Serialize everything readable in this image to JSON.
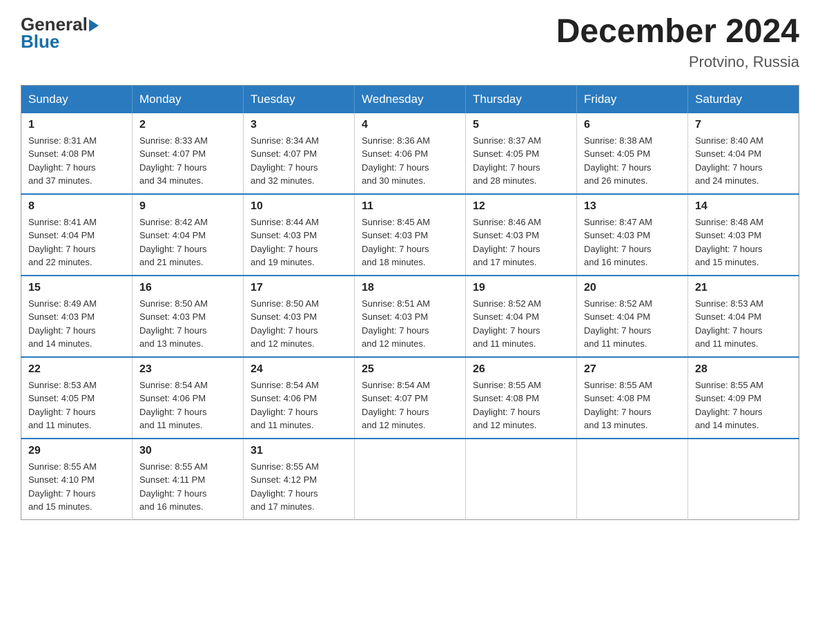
{
  "logo": {
    "general": "General",
    "blue": "Blue"
  },
  "title": "December 2024",
  "location": "Protvino, Russia",
  "weekdays": [
    "Sunday",
    "Monday",
    "Tuesday",
    "Wednesday",
    "Thursday",
    "Friday",
    "Saturday"
  ],
  "weeks": [
    [
      {
        "day": "1",
        "sunrise": "8:31 AM",
        "sunset": "4:08 PM",
        "daylight": "7 hours and 37 minutes."
      },
      {
        "day": "2",
        "sunrise": "8:33 AM",
        "sunset": "4:07 PM",
        "daylight": "7 hours and 34 minutes."
      },
      {
        "day": "3",
        "sunrise": "8:34 AM",
        "sunset": "4:07 PM",
        "daylight": "7 hours and 32 minutes."
      },
      {
        "day": "4",
        "sunrise": "8:36 AM",
        "sunset": "4:06 PM",
        "daylight": "7 hours and 30 minutes."
      },
      {
        "day": "5",
        "sunrise": "8:37 AM",
        "sunset": "4:05 PM",
        "daylight": "7 hours and 28 minutes."
      },
      {
        "day": "6",
        "sunrise": "8:38 AM",
        "sunset": "4:05 PM",
        "daylight": "7 hours and 26 minutes."
      },
      {
        "day": "7",
        "sunrise": "8:40 AM",
        "sunset": "4:04 PM",
        "daylight": "7 hours and 24 minutes."
      }
    ],
    [
      {
        "day": "8",
        "sunrise": "8:41 AM",
        "sunset": "4:04 PM",
        "daylight": "7 hours and 22 minutes."
      },
      {
        "day": "9",
        "sunrise": "8:42 AM",
        "sunset": "4:04 PM",
        "daylight": "7 hours and 21 minutes."
      },
      {
        "day": "10",
        "sunrise": "8:44 AM",
        "sunset": "4:03 PM",
        "daylight": "7 hours and 19 minutes."
      },
      {
        "day": "11",
        "sunrise": "8:45 AM",
        "sunset": "4:03 PM",
        "daylight": "7 hours and 18 minutes."
      },
      {
        "day": "12",
        "sunrise": "8:46 AM",
        "sunset": "4:03 PM",
        "daylight": "7 hours and 17 minutes."
      },
      {
        "day": "13",
        "sunrise": "8:47 AM",
        "sunset": "4:03 PM",
        "daylight": "7 hours and 16 minutes."
      },
      {
        "day": "14",
        "sunrise": "8:48 AM",
        "sunset": "4:03 PM",
        "daylight": "7 hours and 15 minutes."
      }
    ],
    [
      {
        "day": "15",
        "sunrise": "8:49 AM",
        "sunset": "4:03 PM",
        "daylight": "7 hours and 14 minutes."
      },
      {
        "day": "16",
        "sunrise": "8:50 AM",
        "sunset": "4:03 PM",
        "daylight": "7 hours and 13 minutes."
      },
      {
        "day": "17",
        "sunrise": "8:50 AM",
        "sunset": "4:03 PM",
        "daylight": "7 hours and 12 minutes."
      },
      {
        "day": "18",
        "sunrise": "8:51 AM",
        "sunset": "4:03 PM",
        "daylight": "7 hours and 12 minutes."
      },
      {
        "day": "19",
        "sunrise": "8:52 AM",
        "sunset": "4:04 PM",
        "daylight": "7 hours and 11 minutes."
      },
      {
        "day": "20",
        "sunrise": "8:52 AM",
        "sunset": "4:04 PM",
        "daylight": "7 hours and 11 minutes."
      },
      {
        "day": "21",
        "sunrise": "8:53 AM",
        "sunset": "4:04 PM",
        "daylight": "7 hours and 11 minutes."
      }
    ],
    [
      {
        "day": "22",
        "sunrise": "8:53 AM",
        "sunset": "4:05 PM",
        "daylight": "7 hours and 11 minutes."
      },
      {
        "day": "23",
        "sunrise": "8:54 AM",
        "sunset": "4:06 PM",
        "daylight": "7 hours and 11 minutes."
      },
      {
        "day": "24",
        "sunrise": "8:54 AM",
        "sunset": "4:06 PM",
        "daylight": "7 hours and 11 minutes."
      },
      {
        "day": "25",
        "sunrise": "8:54 AM",
        "sunset": "4:07 PM",
        "daylight": "7 hours and 12 minutes."
      },
      {
        "day": "26",
        "sunrise": "8:55 AM",
        "sunset": "4:08 PM",
        "daylight": "7 hours and 12 minutes."
      },
      {
        "day": "27",
        "sunrise": "8:55 AM",
        "sunset": "4:08 PM",
        "daylight": "7 hours and 13 minutes."
      },
      {
        "day": "28",
        "sunrise": "8:55 AM",
        "sunset": "4:09 PM",
        "daylight": "7 hours and 14 minutes."
      }
    ],
    [
      {
        "day": "29",
        "sunrise": "8:55 AM",
        "sunset": "4:10 PM",
        "daylight": "7 hours and 15 minutes."
      },
      {
        "day": "30",
        "sunrise": "8:55 AM",
        "sunset": "4:11 PM",
        "daylight": "7 hours and 16 minutes."
      },
      {
        "day": "31",
        "sunrise": "8:55 AM",
        "sunset": "4:12 PM",
        "daylight": "7 hours and 17 minutes."
      },
      null,
      null,
      null,
      null
    ]
  ],
  "labels": {
    "sunrise": "Sunrise: ",
    "sunset": "Sunset: ",
    "daylight": "Daylight: "
  }
}
